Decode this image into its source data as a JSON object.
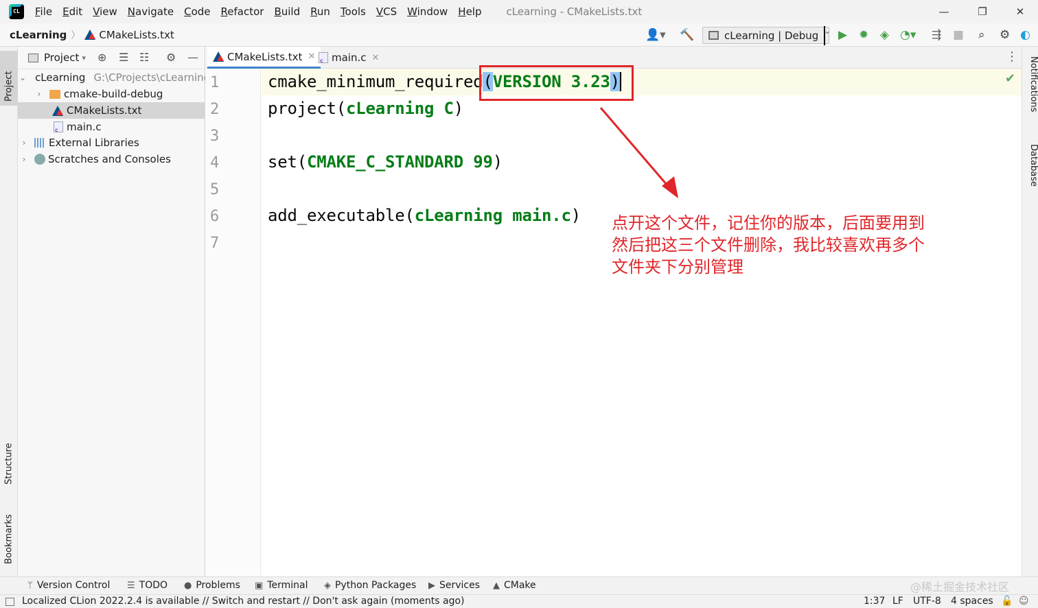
{
  "titlebar": {
    "logo_text": "CL",
    "menu": [
      "File",
      "Edit",
      "View",
      "Navigate",
      "Code",
      "Refactor",
      "Build",
      "Run",
      "Tools",
      "VCS",
      "Window",
      "Help"
    ],
    "window_title": "cLearning - CMakeLists.txt",
    "minimize": "—",
    "restore": "❐",
    "close": "✕"
  },
  "navbar": {
    "project": "cLearning",
    "separator": "〉",
    "file": "CMakeLists.txt",
    "run_config": "cLearning | Debug"
  },
  "left_stripe": {
    "project": "Project",
    "structure": "Structure",
    "bookmarks": "Bookmarks"
  },
  "right_stripe": {
    "notifications": "Notifications",
    "database": "Database"
  },
  "project_panel": {
    "title": "Project",
    "tree": [
      {
        "label": "cLearning",
        "hint": "G:\\CProjects\\cLearning"
      },
      {
        "label": "cmake-build-debug"
      },
      {
        "label": "CMakeLists.txt"
      },
      {
        "label": "main.c"
      },
      {
        "label": "External Libraries"
      },
      {
        "label": "Scratches and Consoles"
      }
    ]
  },
  "editor": {
    "tabs": [
      {
        "label": "CMakeLists.txt",
        "close": "✕"
      },
      {
        "label": "main.c",
        "close": "✕"
      }
    ],
    "line_numbers": [
      "1",
      "2",
      "3",
      "4",
      "5",
      "6",
      "7"
    ],
    "code": {
      "l1_fn": "cmake_minimum_required",
      "l1_open": "(",
      "l1_arg": "VERSION 3.23",
      "l1_close": ")",
      "l2_fn": "project(",
      "l2_arg": "cLearning C",
      "l2_close": ")",
      "l4_fn": "set(",
      "l4_arg": "CMAKE_C_STANDARD 99",
      "l4_close": ")",
      "l6_fn": "add_executable(",
      "l6_arg": "cLearning main.c",
      "l6_close": ")"
    }
  },
  "annotation": {
    "lines": [
      "点开这个文件，记住你的版本，后面要用到",
      "然后把这三个文件删除，我比较喜欢再多个",
      "文件夹下分别管理"
    ],
    "color": "#e0262a"
  },
  "bottom_tools": [
    "Version Control",
    "TODO",
    "Problems",
    "Terminal",
    "Python Packages",
    "Services",
    "CMake"
  ],
  "watermark": "@稀土掘金技术社区",
  "status": {
    "message": "Localized CLion 2022.2.4 is available // Switch and restart // Don't ask again (moments ago)",
    "position": "1:37",
    "line_sep": "LF",
    "encoding": "UTF-8",
    "indent": "4 spaces"
  }
}
